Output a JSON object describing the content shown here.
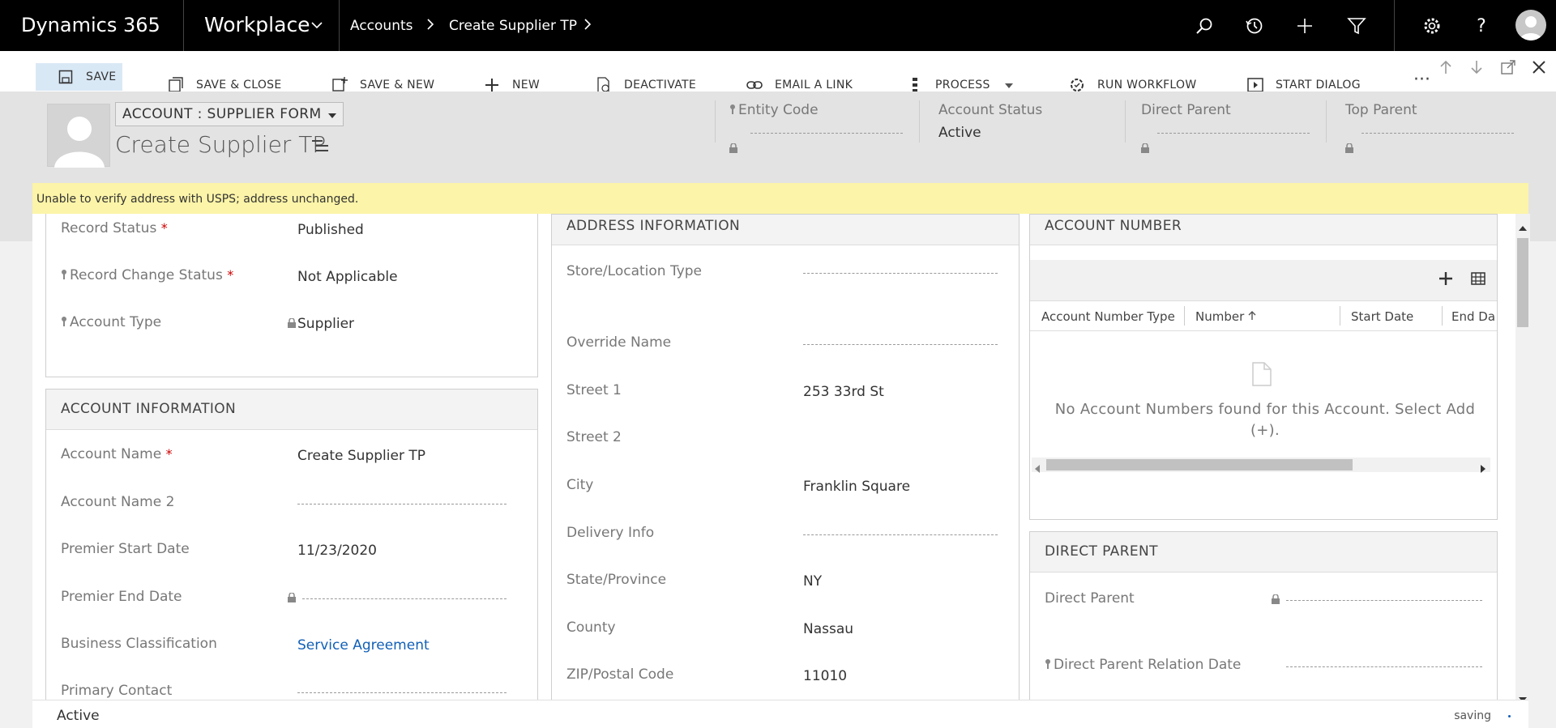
{
  "nav": {
    "brand": "Dynamics 365",
    "app": "Workplace",
    "breadcrumb": [
      "Accounts",
      "Create Supplier TP"
    ]
  },
  "commands": [
    {
      "label": "SAVE",
      "icon": "save-icon"
    },
    {
      "label": "SAVE & CLOSE",
      "icon": "save-close-icon"
    },
    {
      "label": "SAVE & NEW",
      "icon": "save-new-icon"
    },
    {
      "label": "NEW",
      "icon": "plus-icon"
    },
    {
      "label": "DEACTIVATE",
      "icon": "deactivate-icon"
    },
    {
      "label": "EMAIL A LINK",
      "icon": "link-icon"
    },
    {
      "label": "PROCESS",
      "icon": "process-icon"
    },
    {
      "label": "RUN WORKFLOW",
      "icon": "workflow-icon"
    },
    {
      "label": "START DIALOG",
      "icon": "dialog-icon"
    }
  ],
  "header": {
    "form_selector": "ACCOUNT : SUPPLIER FORM",
    "title": "Create Supplier TP",
    "fields": [
      {
        "label": "Entity Code",
        "value": ""
      },
      {
        "label": "Account Status",
        "value": "Active"
      },
      {
        "label": "Direct Parent",
        "value": ""
      },
      {
        "label": "Top Parent",
        "value": ""
      }
    ]
  },
  "notification": "Unable to verify address with USPS; address unchanged.",
  "general": {
    "record_status_label": "Record Status",
    "record_status_value": "Published",
    "record_change_label": "Record Change Status",
    "record_change_value": "Not Applicable",
    "account_type_label": "Account Type",
    "account_type_value": "Supplier"
  },
  "account_info": {
    "title": "ACCOUNT INFORMATION",
    "account_name_label": "Account Name",
    "account_name_value": "Create Supplier TP",
    "account_name2_label": "Account Name 2",
    "premier_start_label": "Premier Start Date",
    "premier_start_value": "11/23/2020",
    "premier_end_label": "Premier End Date",
    "business_class_label": "Business Classification",
    "business_class_value": "Service Agreement",
    "primary_contact_label": "Primary Contact"
  },
  "address": {
    "title": "ADDRESS INFORMATION",
    "store_type_label": "Store/Location Type",
    "override_name_label": "Override Name",
    "street1_label": "Street 1",
    "street1_value": "253 33rd St",
    "street2_label": "Street 2",
    "city_label": "City",
    "city_value": "Franklin Square",
    "delivery_label": "Delivery Info",
    "state_label": "State/Province",
    "state_value": "NY",
    "county_label": "County",
    "county_value": "Nassau",
    "zip_label": "ZIP/Postal Code",
    "zip_value": "11010"
  },
  "account_number": {
    "title": "ACCOUNT NUMBER",
    "columns": [
      "Account Number Type",
      "Number",
      "Start Date",
      "End Da"
    ],
    "empty_message": "No Account Numbers found for this Account. Select Add (+)."
  },
  "direct_parent": {
    "title": "DIRECT PARENT",
    "parent_label": "Direct Parent",
    "relation_date_label": "Direct Parent Relation Date"
  },
  "footer": {
    "status": "Active",
    "saving": "saving"
  },
  "colors": {
    "nav_bg": "#000000",
    "link": "#1160b7",
    "notification_bg": "#fcf4a8",
    "required": "#cc0000"
  }
}
